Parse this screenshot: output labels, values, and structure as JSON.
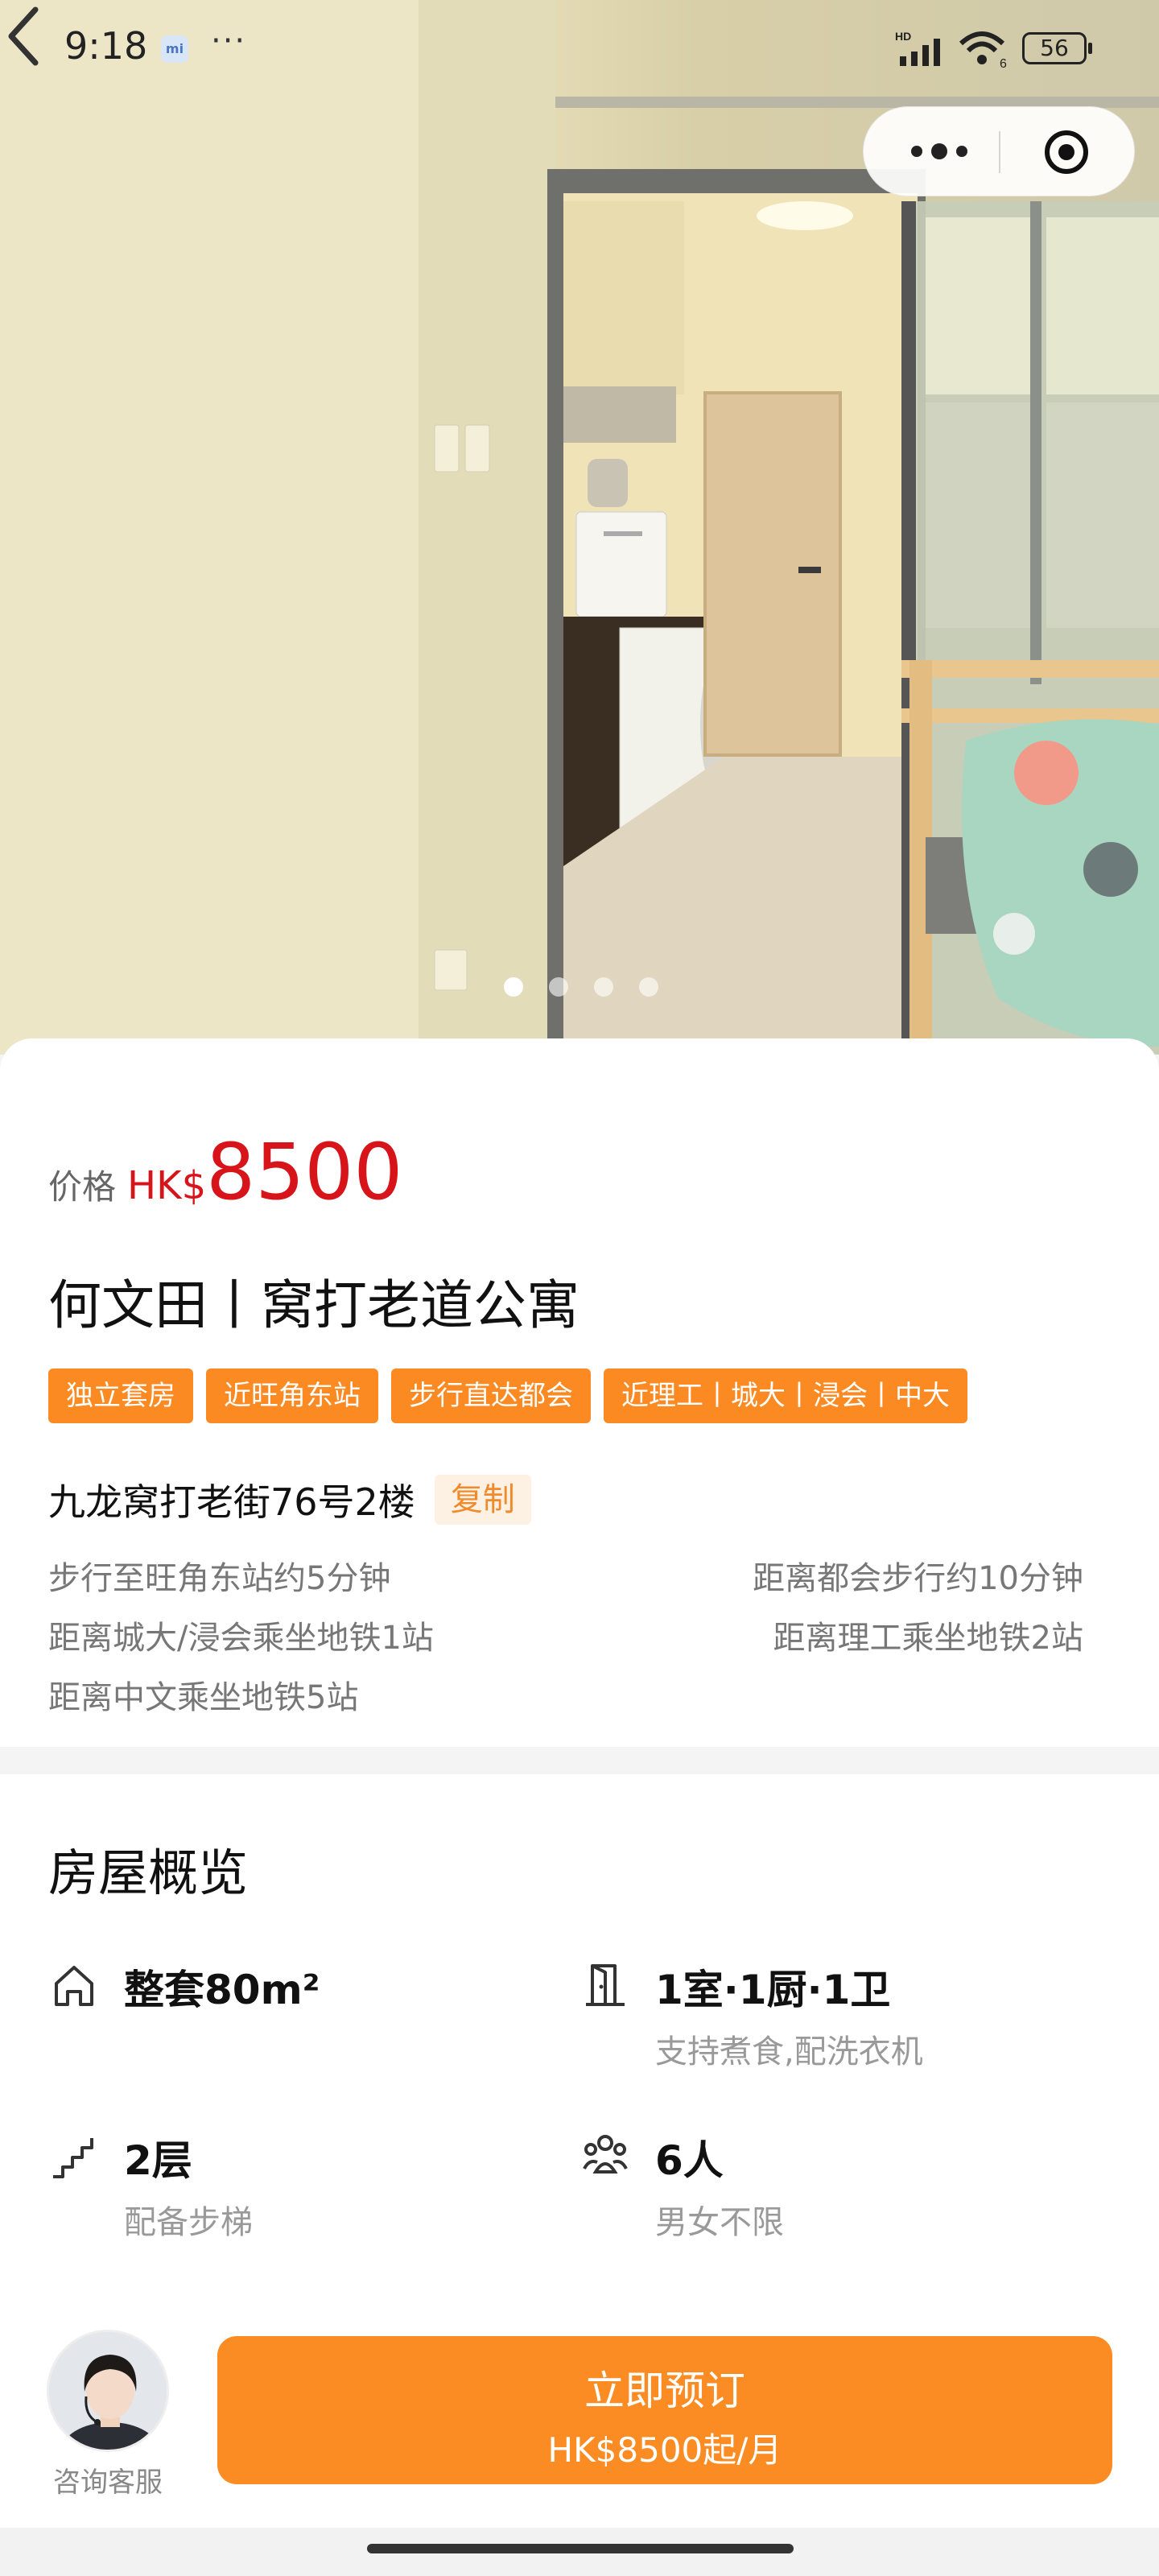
{
  "status_bar": {
    "time": "9:18",
    "app_badge": "mi",
    "more": "···",
    "network": "HD",
    "wifi_gen": "6",
    "battery": "56"
  },
  "gallery": {
    "page_count": 4,
    "active_index": 0
  },
  "listing": {
    "price_label": "价格",
    "currency": "HK$",
    "price": "8500",
    "title": "何文田丨窝打老道公寓",
    "tags": [
      "独立套房",
      "近旺角东站",
      "步行直达都会",
      "近理工丨城大丨浸会丨中大"
    ],
    "address": "九龙窝打老街76号2楼",
    "copy_label": "复制",
    "transit": [
      [
        "步行至旺角东站约5分钟",
        "距离都会步行约10分钟"
      ],
      [
        "距离城大/浸会乘坐地铁1站",
        "距离理工乘坐地铁2站"
      ],
      [
        "距离中文乘坐地铁5站",
        ""
      ]
    ]
  },
  "overview": {
    "title": "房屋概览",
    "features": [
      {
        "icon": "house-icon",
        "main": "整套80m²",
        "sub": ""
      },
      {
        "icon": "door-icon",
        "main": "1室·1厨·1卫",
        "sub": "支持煮食,配洗衣机"
      },
      {
        "icon": "stairs-icon",
        "main": "2层",
        "sub": "配备步梯"
      },
      {
        "icon": "people-icon",
        "main": "6人",
        "sub": "男女不限"
      }
    ]
  },
  "bottom_bar": {
    "service_label": "咨询客服",
    "book_label": "立即预订",
    "book_price": "HK$8500起/月"
  },
  "colors": {
    "accent": "#fa8c23",
    "price": "#d8141b"
  }
}
